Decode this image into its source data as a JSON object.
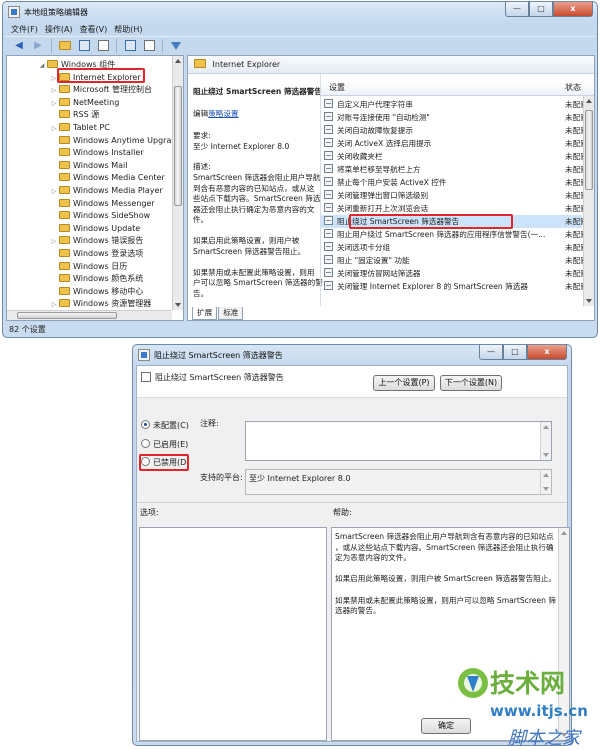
{
  "main_window": {
    "title": "本地组策略编辑器",
    "controls": {
      "minimize": "—",
      "maximize": "□",
      "close": "x"
    },
    "menu": [
      "文件(F)",
      "操作(A)",
      "查看(V)",
      "帮助(H)"
    ],
    "tree": {
      "items": [
        {
          "label": "Windows 组件",
          "expander": "◢"
        },
        {
          "label": "Internet Explorer",
          "expander": "▷"
        },
        {
          "label": "Microsoft 管理控制台",
          "expander": "▷"
        },
        {
          "label": "NetMeeting",
          "expander": "▷"
        },
        {
          "label": "RSS 源",
          "expander": ""
        },
        {
          "label": "Tablet PC",
          "expander": "▷"
        },
        {
          "label": "Windows Anytime Upgrade",
          "expander": ""
        },
        {
          "label": "Windows Installer",
          "expander": ""
        },
        {
          "label": "Windows Mail",
          "expander": ""
        },
        {
          "label": "Windows Media Center",
          "expander": ""
        },
        {
          "label": "Windows Media Player",
          "expander": "▷"
        },
        {
          "label": "Windows Messenger",
          "expander": ""
        },
        {
          "label": "Windows SideShow",
          "expander": ""
        },
        {
          "label": "Windows Update",
          "expander": ""
        },
        {
          "label": "Windows 错误报告",
          "expander": "▷"
        },
        {
          "label": "Windows 登录选项",
          "expander": ""
        },
        {
          "label": "Windows 日历",
          "expander": ""
        },
        {
          "label": "Windows 颜色系统",
          "expander": ""
        },
        {
          "label": "Windows 移动中心",
          "expander": ""
        },
        {
          "label": "Windows 资源管理器",
          "expander": "▷"
        }
      ]
    },
    "right_header": "Internet Explorer",
    "description": {
      "title": "阻止绕过 SmartScreen 筛选器警告",
      "edit_prefix": "编辑",
      "edit_link": "策略设置",
      "req_label": "要求:",
      "req_value": "至少 Internet Explorer 8.0",
      "desc_label": "描述:",
      "lines": [
        "SmartScreen 筛选器会阻止用户导航",
        "到含有恶意内容的已知站点，或从这",
        "些站点下载内容。SmartScreen 筛选",
        "器还会阻止执行确定为恶意内容的文",
        "件。",
        "",
        "如果启用此策略设置，则用户被",
        "SmartScreen 筛选器警告阻止。",
        "",
        "如果禁用或未配置此策略设置，则用",
        "户可以忽略 SmartScreen 筛选器的警",
        "告。"
      ]
    },
    "list": {
      "col_setting": "设置",
      "col_state": "状态",
      "rows": [
        {
          "name": "自定义用户代理字符串",
          "state": "未配置"
        },
        {
          "name": "对账号连接使用 \"自动检测\"",
          "state": "未配置"
        },
        {
          "name": "关闭自动故障恢复提示",
          "state": "未配置"
        },
        {
          "name": "关闭 ActiveX 选择启用提示",
          "state": "未配置"
        },
        {
          "name": "关闭收藏夹栏",
          "state": "未配置"
        },
        {
          "name": "将菜单栏移至导航栏上方",
          "state": "未配置"
        },
        {
          "name": "禁止每个用户安装 ActiveX 控件",
          "state": "未配置"
        },
        {
          "name": "关闭管理弹出窗口筛选级别",
          "state": "未配置"
        },
        {
          "name": "关闭重新打开上次浏览会话",
          "state": "未配置"
        },
        {
          "name": "阻止绕过 SmartScreen 筛选器警告",
          "state": "未配置"
        },
        {
          "name": "阻止用户绕过 SmartScreen 筛选器的应用程序信誉警告(一...",
          "state": "未配置"
        },
        {
          "name": "关闭选项卡分组",
          "state": "未配置"
        },
        {
          "name": "阻止 \"固定设置\" 功能",
          "state": "未配置"
        },
        {
          "name": "关闭管理仿冒网站筛选器",
          "state": "未配置"
        },
        {
          "name": "关闭管理 Internet Explorer 8 的 SmartScreen 筛选器",
          "state": "未配置"
        }
      ]
    },
    "tabs": [
      "扩展",
      "标准"
    ],
    "status": "82 个设置"
  },
  "dialog": {
    "title": "阻止绕过 SmartScreen 筛选器警告",
    "controls": {
      "minimize": "—",
      "maximize": "□",
      "close": "x"
    },
    "header_label": "阻止绕过 SmartScreen 筛选器警告",
    "prev_button": "上一个设置(P)",
    "next_button": "下一个设置(N)",
    "options": [
      {
        "label": "未配置(C)",
        "checked": true
      },
      {
        "label": "已启用(E)",
        "checked": false
      },
      {
        "label": "已禁用(D)",
        "checked": false
      }
    ],
    "comment_label": "注释:",
    "platform_label": "支持的平台:",
    "platform_value": "至少 Internet Explorer 8.0",
    "options_label": "选项:",
    "help_label": "帮助:",
    "help_lines": [
      "SmartScreen 筛选器会阻止用户导航到含有恶意内容的已知站点",
      "，或从这些站点下载内容。SmartScreen 筛选器还会阻止执行确",
      "定为恶意内容的文件。",
      "",
      "如果启用此策略设置，则用户被 SmartScreen 筛选器警告阻止。",
      "",
      "如果禁用或未配置此策略设置，则用户可以忽略 SmartScreen 筛",
      "选器的警告。"
    ],
    "ok_button": "确定"
  },
  "watermark": {
    "text": "技术网",
    "url": "www.itjs.cn",
    "footer": "脚本之家"
  },
  "colors": {
    "highlight": "#e0262c",
    "accent": "#3b6ea8",
    "watermark_green": "#6aae3c",
    "watermark_blue": "#2f7fc8"
  }
}
